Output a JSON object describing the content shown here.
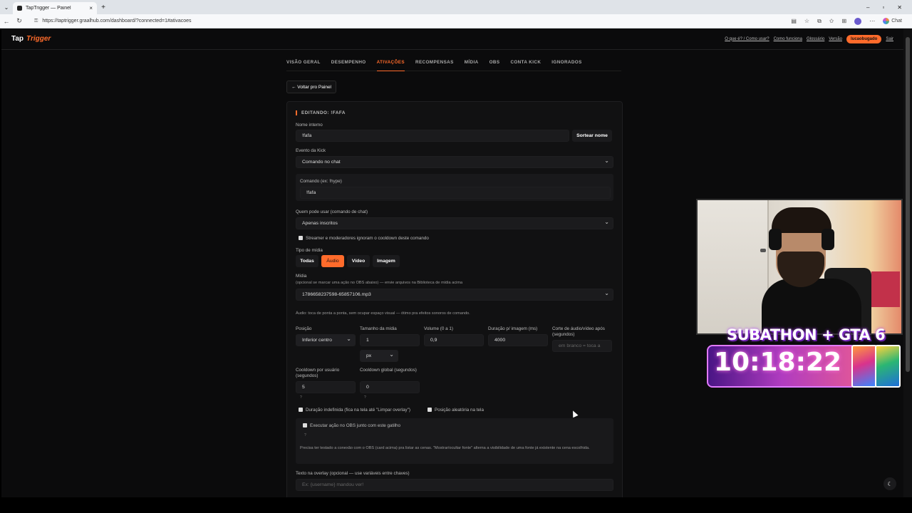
{
  "browser": {
    "tab_title": "TapTrigger — Painel",
    "url": "https://taptrigger.graalhub.com/dashboard/?connected=1#ativacoes",
    "chat_label": "Chat"
  },
  "header": {
    "brand_part1": "Tap",
    "brand_part2": "Trigger",
    "links": [
      "O que é? / Como usar?",
      "Como funciona",
      "Glossário",
      "Versão"
    ],
    "user": "lucaobugado",
    "logout": "Sair"
  },
  "tabs": [
    "VISÃO GERAL",
    "DESEMPENHO",
    "ATIVAÇÕES",
    "RECOMPENSAS",
    "MÍDIA",
    "OBS",
    "CONTA KICK",
    "IGNORADOS"
  ],
  "back_button": "← Voltar pro Painel",
  "form": {
    "title": "EDITANDO: !FAFA",
    "nome_label": "Nome interno",
    "nome_value": "!fafa",
    "sortear_button": "Sortear nome",
    "evento_label": "Evento da Kick",
    "evento_value": "Comando no chat",
    "comando_label": "Comando (ex: !hype)",
    "comando_value": "!fafa",
    "quem_label": "Quem pode usar (comando de chat)",
    "quem_value": "Apenas inscritos",
    "ignore_cooldown_label": "Streamer e moderadores ignoram o cooldown deste comando",
    "tipo_label": "Tipo de mídia",
    "tipo_options": [
      "Todas",
      "Áudio",
      "Vídeo",
      "Imagem"
    ],
    "midia_label": "Mídia",
    "midia_hint": "(opcional se marcar uma ação no OBS abaixo) — envie arquivos na Biblioteca de mídia acima",
    "midia_value": "1786658237598-65857106.mp3",
    "audio_hint": "Áudio: toca de ponta a ponta, sem ocupar espaço visual — ótimo pra efeitos sonoros de comando.",
    "posicao_label": "Posição",
    "posicao_value": "Inferior centro",
    "tamanho_label": "Tamanho da mídia",
    "tamanho_value": "1",
    "unidade_value": "px",
    "volume_label": "Volume (0 a 1)",
    "volume_value": "0,9",
    "duracao_label": "Duração p/ imagem (ms)",
    "duracao_value": "4000",
    "corte_label": "Corte de áudio/vídeo após (segundos)",
    "corte_placeholder": "em branco = toca a",
    "cooldown_user_label": "Cooldown por usuário (segundos)",
    "cooldown_user_value": "5",
    "cooldown_global_label": "Cooldown global (segundos)",
    "cooldown_global_value": "0",
    "question_mark": "?",
    "duracao_indef_label": "Duração indefinida (fica na tela até \"Limpar overlay\")",
    "posicao_aleatoria_label": "Posição aleatória na tela",
    "obs_label": "Executar ação no OBS junto com este gatilho",
    "obs_hint": "Precisa ter testado a conexão com o OBS (card acima) pra listar as cenas. \"Mostrar/ocultar fonte\" alterna a visibilidade de uma fonte já existente na cena escolhida.",
    "overlay_label": "Texto na overlay (opcional — use variáveis entre chaves)",
    "overlay_placeholder": "Ex: {username} mandou ver!"
  },
  "stream_overlay": {
    "title": "SUBATHON + GTA 6",
    "timer": "10:18:22"
  }
}
